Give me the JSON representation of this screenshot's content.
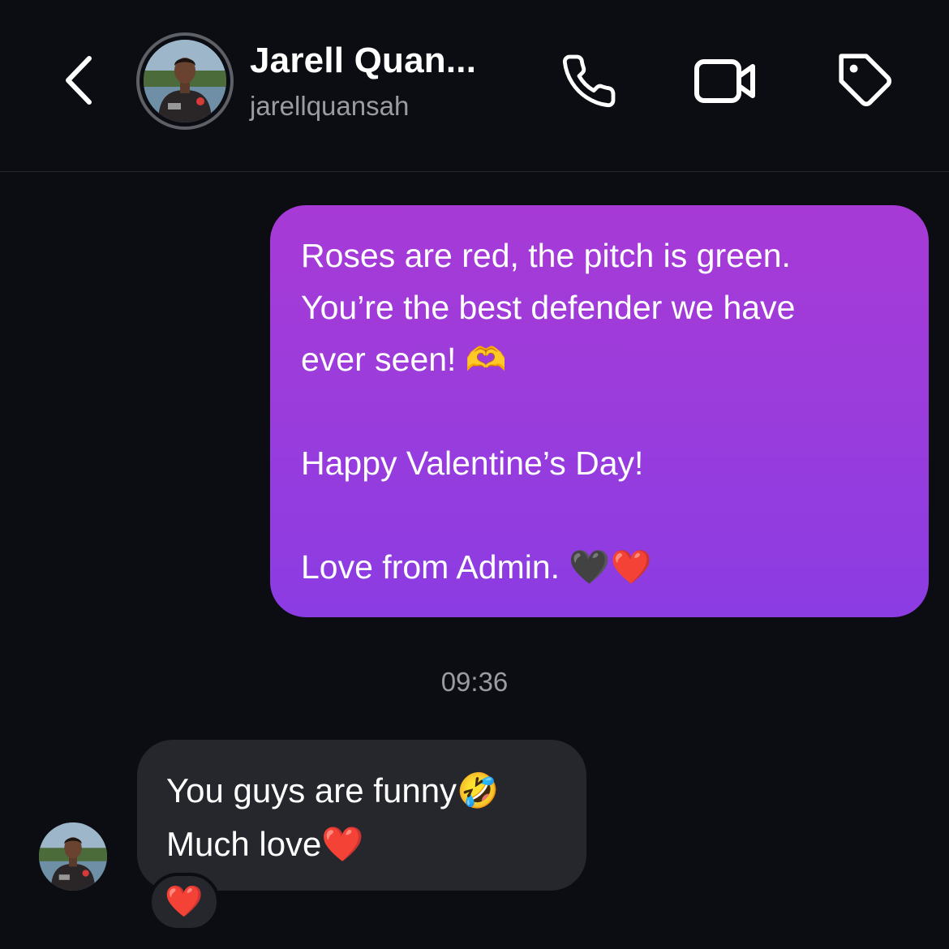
{
  "header": {
    "name": "Jarell Quan...",
    "username": "jarellquansah"
  },
  "messages": {
    "outgoing": {
      "line1": "Roses are red, the pitch is green.",
      "line2": "You’re the best defender we have",
      "line3": "ever seen! 🫶",
      "line4": "Happy Valentine’s Day!",
      "line5": "Love from Admin. 🖤❤️"
    },
    "timestamp": "09:36",
    "incoming": {
      "line1": "You guys are funny🤣",
      "line2": "Much love❤️",
      "reaction": "❤️"
    }
  },
  "icons": [
    "chevron-left-icon",
    "phone-icon",
    "video-icon",
    "tag-icon"
  ]
}
